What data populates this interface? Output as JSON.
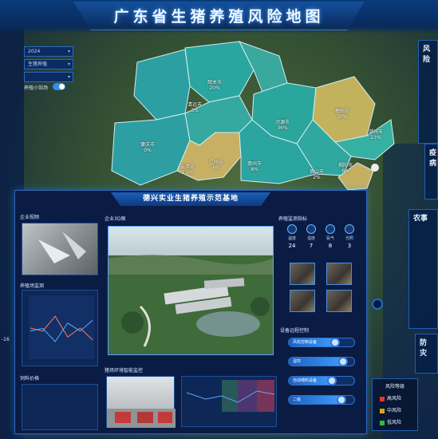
{
  "header": {
    "title": "广东省生猪养殖风险地图"
  },
  "controls": {
    "year": "2024",
    "type": "生猪养殖",
    "third": "",
    "toggle_label": "养殖小馆场"
  },
  "map_labels": [
    {
      "name": "韶关市",
      "pct": "20%"
    },
    {
      "name": "清远市",
      "pct": "3%"
    },
    {
      "name": "河源市",
      "pct": "36%"
    },
    {
      "name": "梅州市",
      "pct": "30%"
    },
    {
      "name": "潮州市",
      "pct": "23%"
    },
    {
      "name": "肇庆市",
      "pct": "0%"
    },
    {
      "name": "云浮市",
      "pct": "1.9%"
    },
    {
      "name": "广州市",
      "pct": "6%"
    },
    {
      "name": "惠州市",
      "pct": "8%"
    },
    {
      "name": "揭阳市",
      "pct": "6%"
    },
    {
      "name": "佛山市",
      "pct": "2%"
    }
  ],
  "right_panels": [
    "风险",
    "疫病",
    "农事",
    "防灾"
  ],
  "dashboard": {
    "title": "德兴实业生猪养殖示范基地",
    "sections": {
      "enterprise": "企业视频",
      "overview": "企业3D图",
      "env": "养殖监测指标",
      "trend": "养殖场监测",
      "ctrl": "设备远程控制",
      "sales": "饲料价格",
      "monitor": "猪场环境智能监控"
    },
    "stats": [
      {
        "label": "温度",
        "value": "24"
      },
      {
        "label": "湿度",
        "value": "7"
      },
      {
        "label": "氨气",
        "value": "8"
      },
      {
        "label": "光照",
        "value": "3"
      }
    ],
    "controls": [
      {
        "label": "风机控制设备",
        "level": 0.78
      },
      {
        "label": "湿帘",
        "level": 0.9
      },
      {
        "label": "自动喂料设备",
        "level": 0.72
      },
      {
        "label": "二级",
        "level": 0.88
      }
    ]
  },
  "legend": {
    "title": "风险等级",
    "items": [
      {
        "label": "高风险",
        "color": "#e8342e"
      },
      {
        "label": "中风险",
        "color": "#e0a21c"
      },
      {
        "label": "低风险",
        "color": "#2fb94a"
      }
    ]
  },
  "bottom_left": "-16",
  "chart_data": {
    "type": "line",
    "series": [
      {
        "values": [
          0.5,
          0.45,
          0.7,
          0.35,
          0.5,
          0.3
        ]
      }
    ]
  }
}
